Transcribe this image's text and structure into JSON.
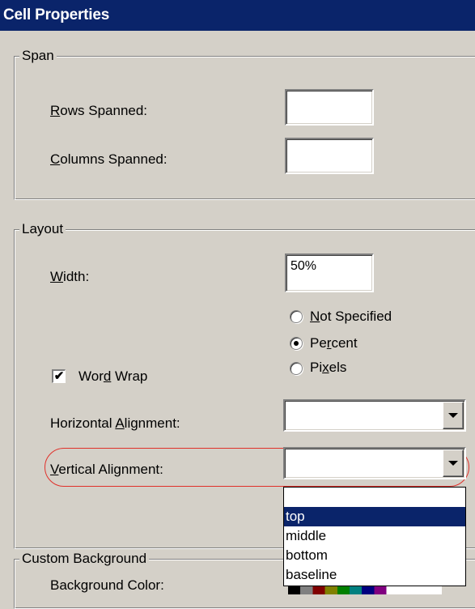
{
  "window": {
    "title": "Cell Properties"
  },
  "span": {
    "legend": "Span",
    "rows_spanned": {
      "mnemonic": "R",
      "rest": "ows Spanned:",
      "value": ""
    },
    "columns_spanned": {
      "mnemonic": "C",
      "rest": "olumns Spanned:",
      "value": ""
    }
  },
  "layout": {
    "legend": "Layout",
    "width": {
      "mnemonic": "W",
      "rest": "idth:",
      "value": "50%"
    },
    "units": {
      "not_specified": {
        "pre": "",
        "mnemonic": "N",
        "rest": "ot Specified",
        "checked": false
      },
      "percent": {
        "pre": "Pe",
        "mnemonic": "r",
        "rest": "cent",
        "checked": true
      },
      "pixels": {
        "pre": "Pi",
        "mnemonic": "x",
        "rest": "els",
        "checked": false
      }
    },
    "word_wrap": {
      "pre": "Wor",
      "mnemonic": "d",
      "rest": " Wrap",
      "checked": true,
      "mark": "✔"
    },
    "horizontal_alignment": {
      "pre": "Horizontal ",
      "mnemonic": "A",
      "rest": "lignment:",
      "value": ""
    },
    "vertical_alignment": {
      "pre": "",
      "mnemonic": "V",
      "rest": "ertical Alignment:",
      "value": "",
      "options": [
        "",
        "top",
        "middle",
        "bottom",
        "baseline"
      ],
      "highlighted": "top"
    }
  },
  "custom_background": {
    "legend": "Custom Background",
    "background_color": {
      "label": "Background Color:"
    }
  },
  "colors": {
    "titlebar": "#0a246a",
    "dialog": "#d4d0c8",
    "highlight_oval": "#e0302a",
    "selection": "#0a246a"
  }
}
